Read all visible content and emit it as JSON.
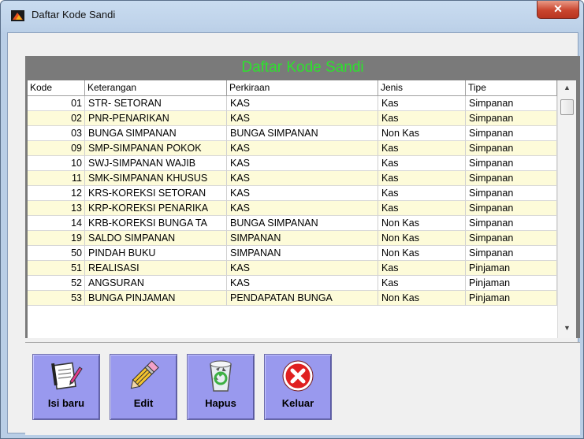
{
  "window": {
    "title": "Daftar Kode Sandi",
    "close_glyph": "✕"
  },
  "grid": {
    "title": "Daftar Kode Sandi",
    "columns": [
      "Kode",
      "Keterangan",
      "Perkiraan",
      "Jenis",
      "Tipe"
    ],
    "rows": [
      [
        "01",
        "STR- SETORAN",
        "KAS",
        "Kas",
        "Simpanan"
      ],
      [
        "02",
        "PNR-PENARIKAN",
        "KAS",
        "Kas",
        "Simpanan"
      ],
      [
        "03",
        "BUNGA SIMPANAN",
        "BUNGA SIMPANAN",
        "Non Kas",
        "Simpanan"
      ],
      [
        "09",
        "SMP-SIMPANAN POKOK",
        "KAS",
        "Kas",
        "Simpanan"
      ],
      [
        "10",
        "SWJ-SIMPANAN WAJIB",
        "KAS",
        "Kas",
        "Simpanan"
      ],
      [
        "11",
        "SMK-SIMPANAN KHUSUS",
        "KAS",
        "Kas",
        "Simpanan"
      ],
      [
        "12",
        "KRS-KOREKSI SETORAN",
        "KAS",
        "Kas",
        "Simpanan"
      ],
      [
        "13",
        "KRP-KOREKSI PENARIKA",
        "KAS",
        "Kas",
        "Simpanan"
      ],
      [
        "14",
        "KRB-KOREKSI BUNGA TA",
        "BUNGA SIMPANAN",
        "Non Kas",
        "Simpanan"
      ],
      [
        "19",
        "SALDO SIMPANAN",
        "SIMPANAN",
        "Non Kas",
        "Simpanan"
      ],
      [
        "50",
        "PINDAH BUKU",
        "SIMPANAN",
        "Non Kas",
        "Simpanan"
      ],
      [
        "51",
        "REALISASI",
        "KAS",
        "Kas",
        "Pinjaman"
      ],
      [
        "52",
        "ANGSURAN",
        "KAS",
        "Kas",
        "Pinjaman"
      ],
      [
        "53",
        "BUNGA PINJAMAN",
        "PENDAPATAN BUNGA",
        "Non Kas",
        "Pinjaman"
      ]
    ]
  },
  "toolbar": {
    "new_label": "Isi baru",
    "edit_label": "Edit",
    "delete_label": "Hapus",
    "exit_label": "Keluar",
    "new_icon": "notepad-pencil-icon",
    "edit_icon": "pencil-icon",
    "delete_icon": "recycle-bin-icon",
    "exit_icon": "red-x-circle-icon"
  },
  "colors": {
    "grid_title": "#2ee02e",
    "grid_bg": "#7a7a7a",
    "alt_row": "#fdfbd9",
    "button_bg": "#9999ee"
  }
}
